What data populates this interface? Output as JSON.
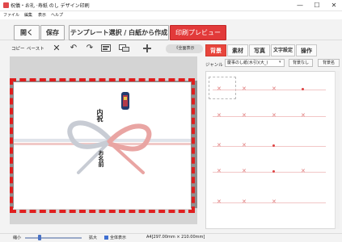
{
  "window": {
    "title": "祝儀・お礼 ·寿紙 のし デザイン印刷",
    "controls": {
      "minimize": "—",
      "maximize": "☐",
      "close": "✕"
    }
  },
  "menu": [
    "ファイル",
    "編集",
    "表示",
    "ヘルプ"
  ],
  "toolbar": {
    "open": "開く",
    "save": "保存",
    "template_select": "テンプレート選択 / 白紙から作成",
    "print_preview": "印刷プレビュー"
  },
  "edit_toolbar": {
    "copy": "コピー",
    "paste": "ペースト",
    "delete_icon": "close-icon",
    "undo_icon": "undo-icon",
    "redo_icon": "redo-icon"
  },
  "right_tabs": {
    "scroll_label": "《全面表示",
    "tabs": [
      "背景",
      "素材",
      "写真",
      "文字設定",
      "操作"
    ]
  },
  "genre": {
    "label": "ジャンル",
    "selected": "慶事のし紙(水引)(大_)",
    "btn_none": "背景なし",
    "btn_register": "背景名"
  },
  "preview": {
    "upper_text": "内祝",
    "lower_text": "お名前"
  },
  "status": {
    "zoom_out": "縮小",
    "zoom_in": "拡大",
    "fit": "全体表示",
    "paper_size": "A4[297.00mm × 210.00mm]"
  },
  "colors": {
    "accent_red": "#e23a3a",
    "dashed_border": "#e01e1e",
    "tab_active": "#e8453c"
  }
}
